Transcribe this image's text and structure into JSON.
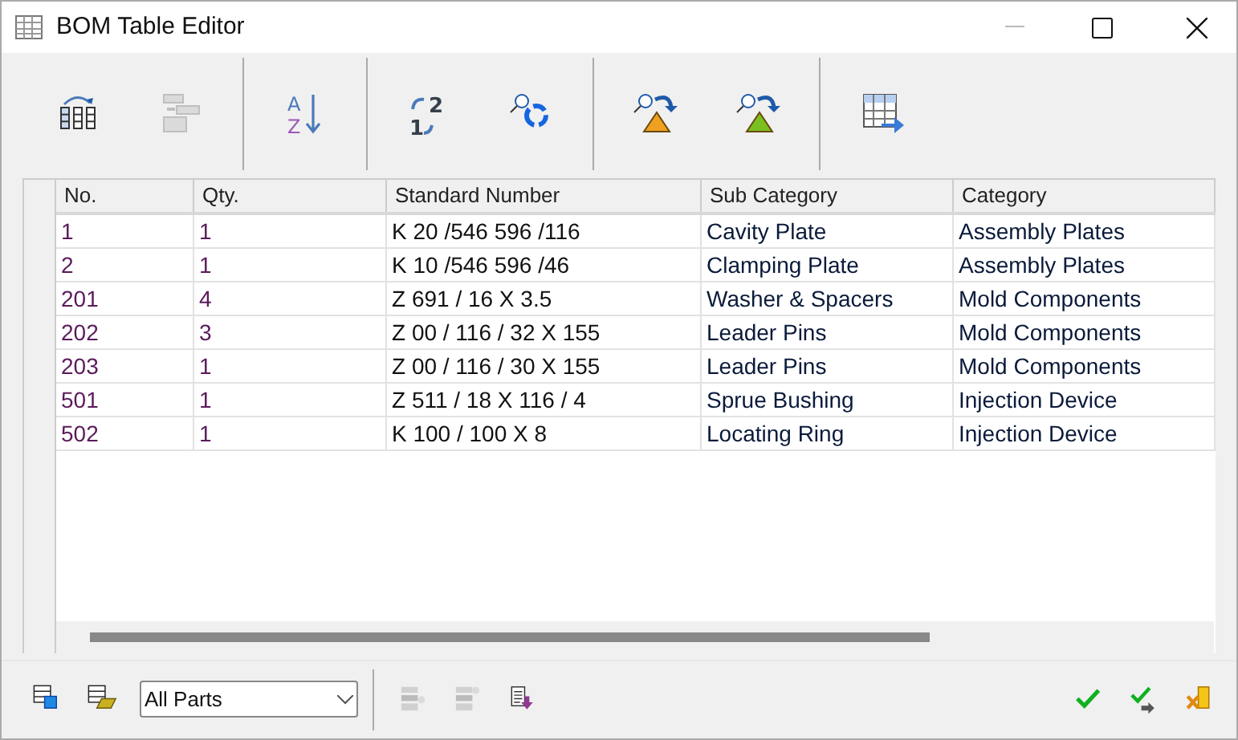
{
  "window": {
    "title": "BOM Table Editor"
  },
  "toolbar": [
    [
      {
        "kind": "columns",
        "disabled": false
      },
      {
        "kind": "merge",
        "disabled": true
      }
    ],
    [
      {
        "kind": "sort",
        "disabled": false,
        "letters": [
          "A",
          "Z"
        ]
      }
    ],
    [
      {
        "kind": "renumber",
        "disabled": false,
        "letters": [
          "2",
          "1"
        ]
      },
      {
        "kind": "refresh",
        "disabled": false
      }
    ],
    [
      {
        "kind": "find-orange",
        "disabled": false
      },
      {
        "kind": "find-green",
        "disabled": false
      }
    ],
    [
      {
        "kind": "export",
        "disabled": false
      }
    ]
  ],
  "table": {
    "columns": [
      "No.",
      "Qty.",
      "Standard Number",
      "Sub Category",
      "Category"
    ],
    "rows": [
      [
        "1",
        "1",
        "K 20 /546 596 /116",
        "Cavity Plate",
        "Assembly Plates"
      ],
      [
        "2",
        "1",
        "K 10 /546 596 /46",
        "Clamping Plate",
        "Assembly Plates"
      ],
      [
        "201",
        "4",
        "Z 691 / 16 X 3.5",
        "Washer & Spacers",
        "Mold Components"
      ],
      [
        "202",
        "3",
        "Z 00 / 116 / 32 X 155",
        "Leader Pins",
        "Mold Components"
      ],
      [
        "203",
        "1",
        "Z 00 / 116 / 30 X 155",
        "Leader Pins",
        "Mold Components"
      ],
      [
        "501",
        "1",
        "Z 511 / 18 X 116 / 4",
        "Sprue Bushing",
        "Injection Device"
      ],
      [
        "502",
        "1",
        "K 100 / 100 X 8",
        "Locating Ring",
        "Injection Device"
      ]
    ]
  },
  "bottom": {
    "left": [
      {
        "kind": "save",
        "disabled": false
      },
      {
        "kind": "open",
        "disabled": false
      }
    ],
    "filter": {
      "value": "All Parts"
    },
    "middle": [
      {
        "kind": "row-add",
        "disabled": true
      },
      {
        "kind": "row-remove",
        "disabled": true
      },
      {
        "kind": "import",
        "disabled": false
      }
    ],
    "right": [
      {
        "kind": "ok",
        "disabled": false
      },
      {
        "kind": "apply",
        "disabled": false
      },
      {
        "kind": "cancel",
        "disabled": false
      }
    ]
  }
}
